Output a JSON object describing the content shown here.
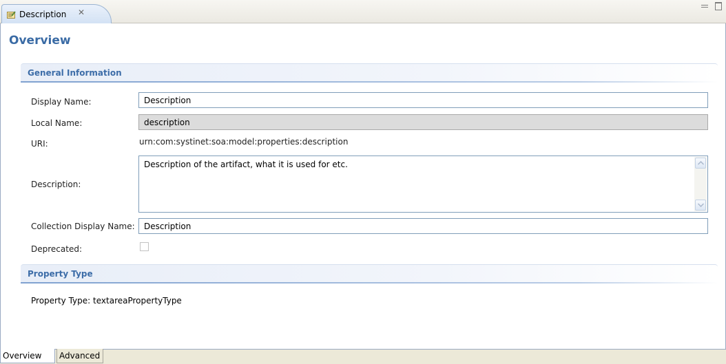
{
  "editor_tab": {
    "label": "Description",
    "icon": "property-edit-icon",
    "close_icon": "close-icon"
  },
  "window_controls": {
    "minimize_icon": "minimize-icon",
    "maximize_icon": "maximize-icon"
  },
  "page": {
    "title": "Overview"
  },
  "general_information": {
    "title": "General Information",
    "display_name": {
      "label": "Display Name:",
      "value": "Description"
    },
    "local_name": {
      "label": "Local Name:",
      "value": "description"
    },
    "uri": {
      "label": "URI:",
      "value": "urn:com:systinet:soa:model:properties:description"
    },
    "description": {
      "label": "Description:",
      "value": "Description of the artifact, what it is used for etc."
    },
    "collection_display_name": {
      "label": "Collection Display Name:",
      "value": "Description"
    },
    "deprecated": {
      "label": "Deprecated:",
      "checked": false
    }
  },
  "property_type": {
    "title": "Property Type",
    "label": "Property Type:",
    "value": "textareaPropertyType"
  },
  "bottom_tabs": [
    {
      "label": "Overview",
      "active": true
    },
    {
      "label": "Advanced",
      "active": false
    }
  ],
  "colors": {
    "accent": "#3a6ba5",
    "section_title": "#3d6da8"
  }
}
